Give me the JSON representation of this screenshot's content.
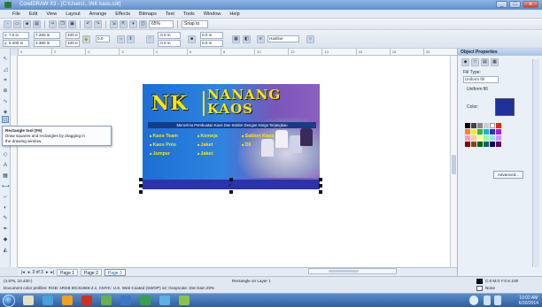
{
  "window": {
    "title": "CorelDRAW X3 - [C:\\Users\\...\\NK kaos.cdr]",
    "controls": [
      "_",
      "□",
      "x"
    ]
  },
  "menu": [
    "File",
    "Edit",
    "View",
    "Layout",
    "Arrange",
    "Effects",
    "Bitmaps",
    "Text",
    "Tools",
    "Window",
    "Help"
  ],
  "toolbar": {
    "zoom": "65%",
    "snap": "Snap to"
  },
  "propbar": {
    "x": "x: 7.0 in",
    "y": "y: 5.400 in",
    "w": "7.260 in",
    "h": "3.380 in",
    "sx": "100.0",
    "sy": "100.0",
    "angle": "0.0",
    "dim_a": ".0.0 in",
    "dim_b": ".0.0 in",
    "stroke_a": "0.0 in",
    "stroke_b": "0.0 in",
    "outline": "Hairline"
  },
  "ruler_ticks": [
    "4",
    "2",
    "0",
    "2",
    "4",
    "6",
    "8",
    "10",
    "12",
    "14",
    "16",
    "18",
    "20"
  ],
  "tooltip": {
    "title": "Rectangle tool (F6)",
    "line1": "Draw squares and rectangles by dragging in",
    "line2": "the drawing window."
  },
  "card": {
    "logo": "NK",
    "brand_line1": "NANANG",
    "brand_line2": "KAOS",
    "tagline": "Menerima Pembuatan Kaos Dan Sablon Dengan Harga Terjangkau",
    "services_col1": [
      "Kaos Team",
      "Kaos Polo",
      "Jumper"
    ],
    "services_col2": [
      "Kemeja",
      "Jaket",
      "Jaket"
    ],
    "services_col3": [
      "Sablon Kaos",
      "Dll"
    ],
    "colors": {
      "bg_left": "#1c6fd4",
      "bg_right": "#8a60c0",
      "text": "#ffe600",
      "band": "#2c33a8"
    }
  },
  "pages": {
    "counter": "3 of 3",
    "tabs": [
      "Page 1",
      "Page 2",
      "Page 3"
    ],
    "active": 2
  },
  "status": {
    "coords": "(4.976, 10.430 )",
    "object": "Rectangle on Layer 1",
    "profile": "Document color profiles: RGB: sRGB IEC61966-2.1; CMYK: U.S. Web Coated (SWOP) v2; Grayscale: Dot Gain 20%",
    "fill_label": "C:0 M:0 Y:0 K:100",
    "outline_label": "None"
  },
  "docker": {
    "title": "Object Properties",
    "fill_type_label": "Fill Type:",
    "fill_type_value": "Uniform fill",
    "uniform_label": "Uniform fill",
    "color_label": "Color:",
    "advanced": "Advanced...",
    "accent": "#1f2f9c"
  },
  "taskbar": {
    "time": "10:02 AM",
    "date": "6/30/2014"
  }
}
